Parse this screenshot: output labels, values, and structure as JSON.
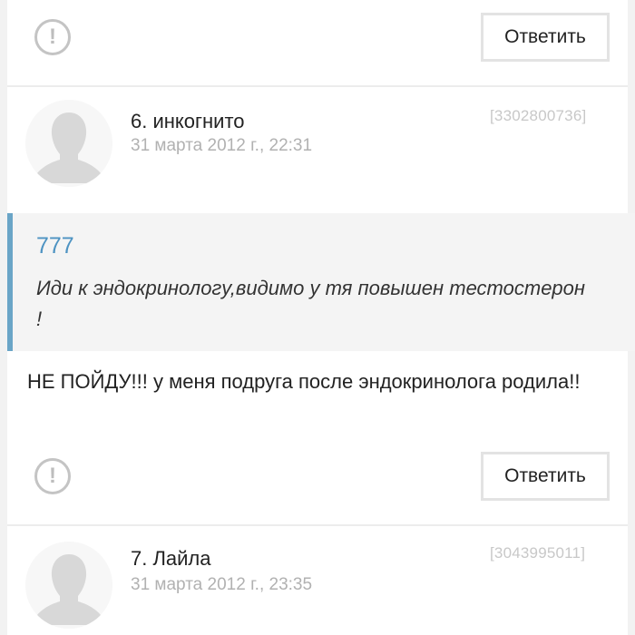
{
  "top_actions": {
    "report_icon": "exclamation-circle-icon",
    "reply_label": "Ответить"
  },
  "comments": [
    {
      "author": "6. инкогнито",
      "date": "31 марта 2012 г., 22:31",
      "id": "[3302800736]",
      "avatar_icon": "silhouette-avatar-icon",
      "quote": {
        "author": "777",
        "text": "Иди к эндокринологу,видимо у тя повышен тестостерон !"
      },
      "body": "НЕ ПОЙДУ!!! у меня подруга после эндокринолога родила!!",
      "reply_label": "Ответить"
    },
    {
      "author": "7. Лайла",
      "date": "31 марта 2012 г., 23:35",
      "id": "[3043995011]",
      "avatar_icon": "silhouette-avatar-icon"
    }
  ],
  "colors": {
    "quote_accent": "#6aa5c7",
    "quote_author": "#4d93c2",
    "muted_text": "#b1b1b1"
  }
}
